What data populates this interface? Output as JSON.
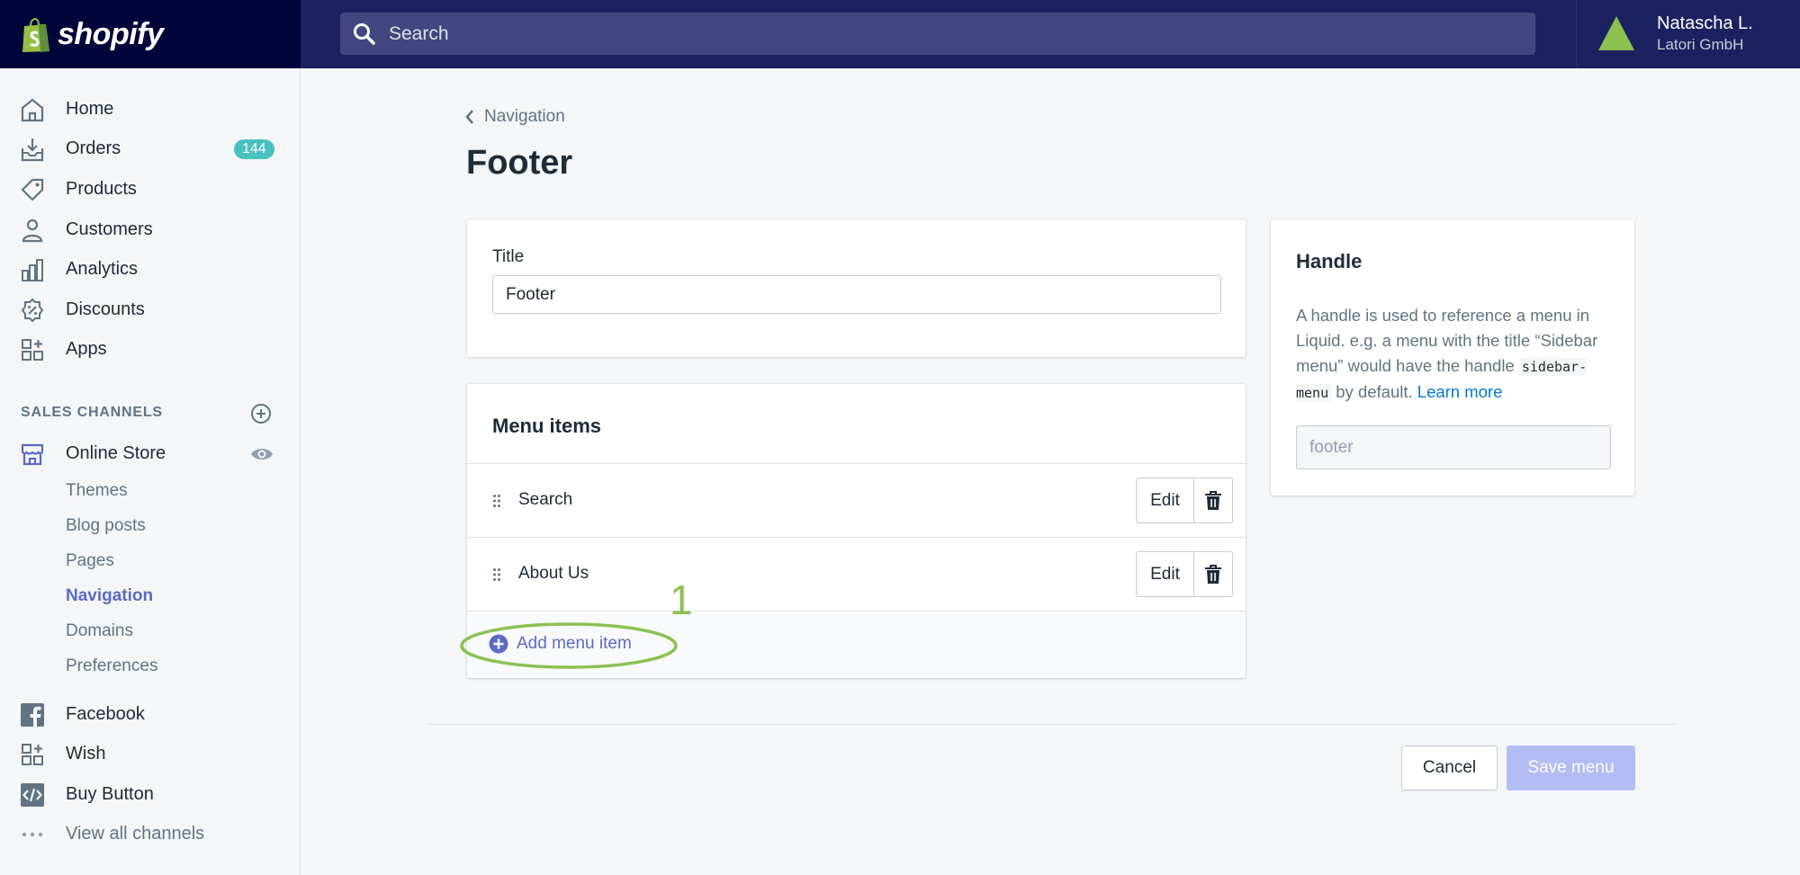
{
  "topbar": {
    "brand": "shopify",
    "search_placeholder": "Search",
    "user_name": "Natascha L.",
    "shop_name": "Latori GmbH"
  },
  "sidebar": {
    "items": [
      {
        "label": "Home",
        "icon": "home-icon"
      },
      {
        "label": "Orders",
        "icon": "orders-icon",
        "badge": "144"
      },
      {
        "label": "Products",
        "icon": "tag-icon"
      },
      {
        "label": "Customers",
        "icon": "person-icon"
      },
      {
        "label": "Analytics",
        "icon": "bar-chart-icon"
      },
      {
        "label": "Discounts",
        "icon": "discount-icon"
      },
      {
        "label": "Apps",
        "icon": "apps-icon"
      }
    ],
    "sales_channels_title": "SALES CHANNELS",
    "online_store": {
      "label": "Online Store",
      "subitems": [
        "Themes",
        "Blog posts",
        "Pages",
        "Navigation",
        "Domains",
        "Preferences"
      ],
      "active": "Navigation"
    },
    "channels": [
      {
        "label": "Facebook",
        "icon": "facebook-icon"
      },
      {
        "label": "Wish",
        "icon": "apps-icon"
      },
      {
        "label": "Buy Button",
        "icon": "code-icon"
      },
      {
        "label": "View all channels",
        "icon": "more-icon"
      }
    ]
  },
  "main": {
    "breadcrumb": "Navigation",
    "title": "Footer",
    "title_field": {
      "label": "Title",
      "value": "Footer"
    },
    "menu": {
      "heading": "Menu items",
      "items": [
        {
          "label": "Search",
          "edit_label": "Edit"
        },
        {
          "label": "About Us",
          "edit_label": "Edit"
        }
      ],
      "add_label": "Add menu item",
      "annotation": "1"
    },
    "handle": {
      "title": "Handle",
      "desc_1": "A handle is used to reference a menu in Liquid. e.g. a menu with the title “Sidebar menu” would have the handle ",
      "code": "sidebar-menu",
      "desc_2": " by default. ",
      "learn_more": "Learn more",
      "value": "footer"
    },
    "actions": {
      "cancel": "Cancel",
      "save": "Save menu"
    }
  },
  "colors": {
    "topbar": "#1c2260",
    "logo_bg": "#000639",
    "accent": "#5c6ac4",
    "badge": "#47c1bf",
    "annotation": "#8cc152",
    "save_disabled": "#b3bcf5"
  }
}
